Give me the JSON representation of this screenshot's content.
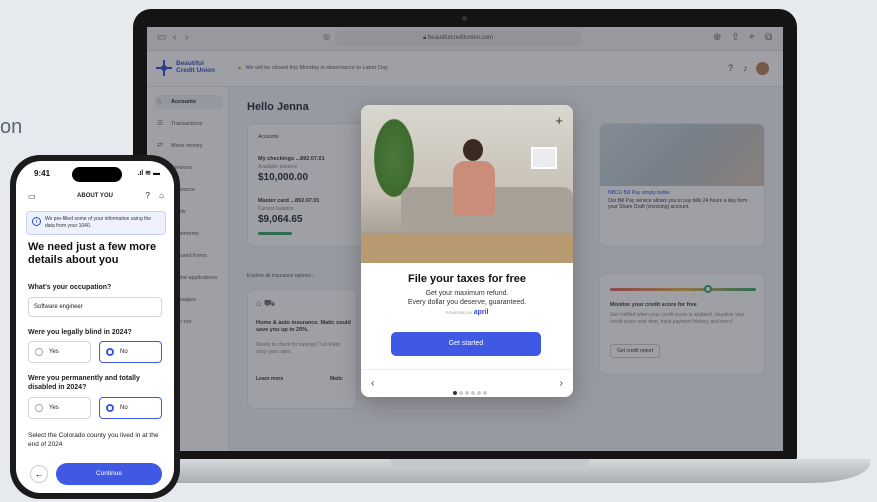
{
  "background_fragment": "on",
  "browser": {
    "url": "beautifulcreditunion.com"
  },
  "bank_app": {
    "logo_line1": "Beautiful",
    "logo_line2": "Credit Union",
    "notice": "We will be closed this Monday in observance to Labor Day",
    "sidebar": [
      {
        "label": "Accounts",
        "icon": "home-icon",
        "active": true
      },
      {
        "label": "Transactions",
        "icon": "list-icon"
      },
      {
        "label": "Move money",
        "icon": "transfer-icon"
      },
      {
        "label": "Services",
        "icon": "services-icon"
      },
      {
        "label": "Insurance",
        "icon": "shield-icon"
      },
      {
        "label": "Cards",
        "icon": "card-icon"
      },
      {
        "label": "Statements",
        "icon": "doc-icon"
      },
      {
        "label": "Secured forms",
        "icon": "lock-icon"
      },
      {
        "label": "Online applications",
        "icon": "form-icon"
      },
      {
        "label": "Messages",
        "icon": "mail-icon"
      },
      {
        "label": "Sign out",
        "icon": "logout-icon"
      }
    ],
    "greeting": "Hello Jenna",
    "accounts_card": {
      "title": "Accounts",
      "checking_label": "My checkings ...892.07.01",
      "checking_sub": "Available balance",
      "checking_amount": "$10,000.00",
      "master_label": "Master card ...892.07.01",
      "master_sub": "Current balance",
      "master_amount": "$9,064.65"
    },
    "explore_link": "Explore all insurance options",
    "insurance_card": {
      "heading": "Home & auto insurance. Matic could save you up to 20%.",
      "text": "Ready to check for savings? Let Matic shop your rates",
      "learn_more": "Learn more",
      "brand": "Matic"
    },
    "billpay_card": {
      "link": "NBCU Bill Pay simply better",
      "text": "Our Bill Pay service allows you to pay bills 24 hours a day form your Share Draft (checking) account."
    },
    "credit_card": {
      "title": "Monitor your credit score for free",
      "text": "Get notified when your credit score is updated, visualize your credit score over time, track payment history, and more!",
      "button": "Get credit report"
    }
  },
  "modal": {
    "title": "File your taxes for free",
    "subtitle_line1": "Get your maximum refund.",
    "subtitle_line2": "Every dollar you deserve, guaranteed.",
    "powered_by": "POWERED BY",
    "brand": "april",
    "cta": "Get started",
    "close_icon": "+",
    "page": 1,
    "pages": 6
  },
  "phone": {
    "time": "9:41",
    "title": "ABOUT YOU",
    "info": "We pre-filled some of your information using the data from your 1040.",
    "heading": "We need just a few more details about you",
    "q1": "What's your occupation?",
    "q1_value": "Software engineer",
    "q2": "Were you legally blind in 2024?",
    "q3": "Were you permanently and totally disabled in 2024?",
    "yes": "Yes",
    "no": "No",
    "q4": "Select the Colorado county you lived in at the end of 2024",
    "continue": "Continue",
    "back": "←"
  }
}
